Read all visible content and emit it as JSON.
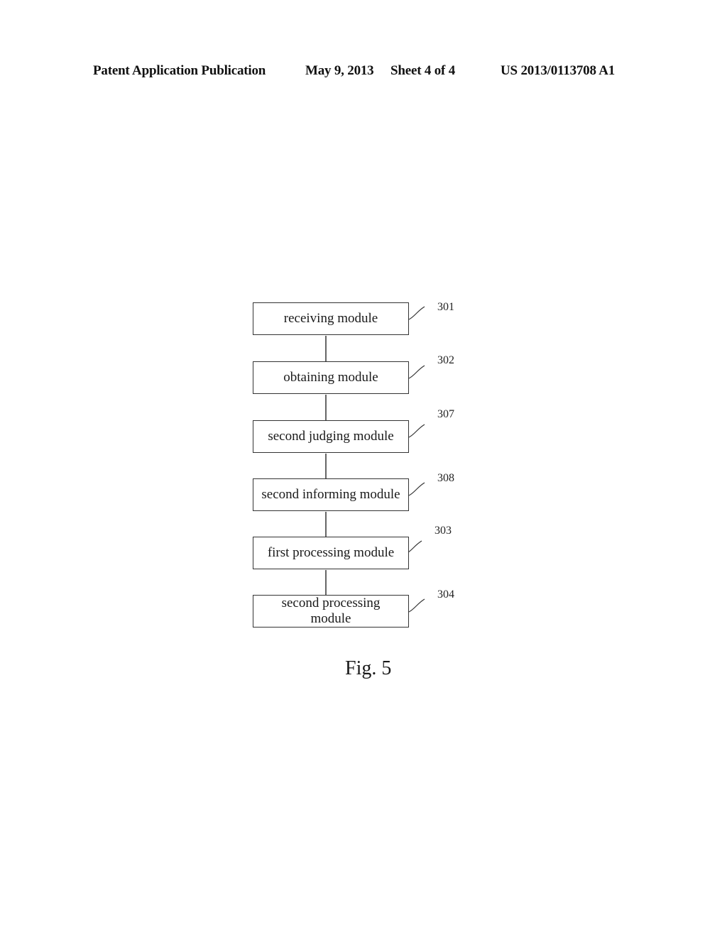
{
  "header": {
    "publication_type": "Patent Application Publication",
    "date": "May 9, 2013",
    "sheet": "Sheet 4 of 4",
    "publication_number": "US 2013/0113708 A1"
  },
  "diagram": {
    "type": "block-flow",
    "modules": [
      {
        "label": "receiving module",
        "ref": "301"
      },
      {
        "label": "obtaining module",
        "ref": "302"
      },
      {
        "label": "second judging module",
        "ref": "307"
      },
      {
        "label": "second informing module",
        "ref": "308"
      },
      {
        "label": "first processing module",
        "ref": "303"
      },
      {
        "label": "second processing module",
        "ref": "304"
      }
    ],
    "connections": [
      [
        "301",
        "302"
      ],
      [
        "302",
        "307"
      ],
      [
        "307",
        "308"
      ],
      [
        "308",
        "303"
      ],
      [
        "303",
        "304"
      ]
    ]
  },
  "figure": {
    "caption": "Fig. 5"
  }
}
